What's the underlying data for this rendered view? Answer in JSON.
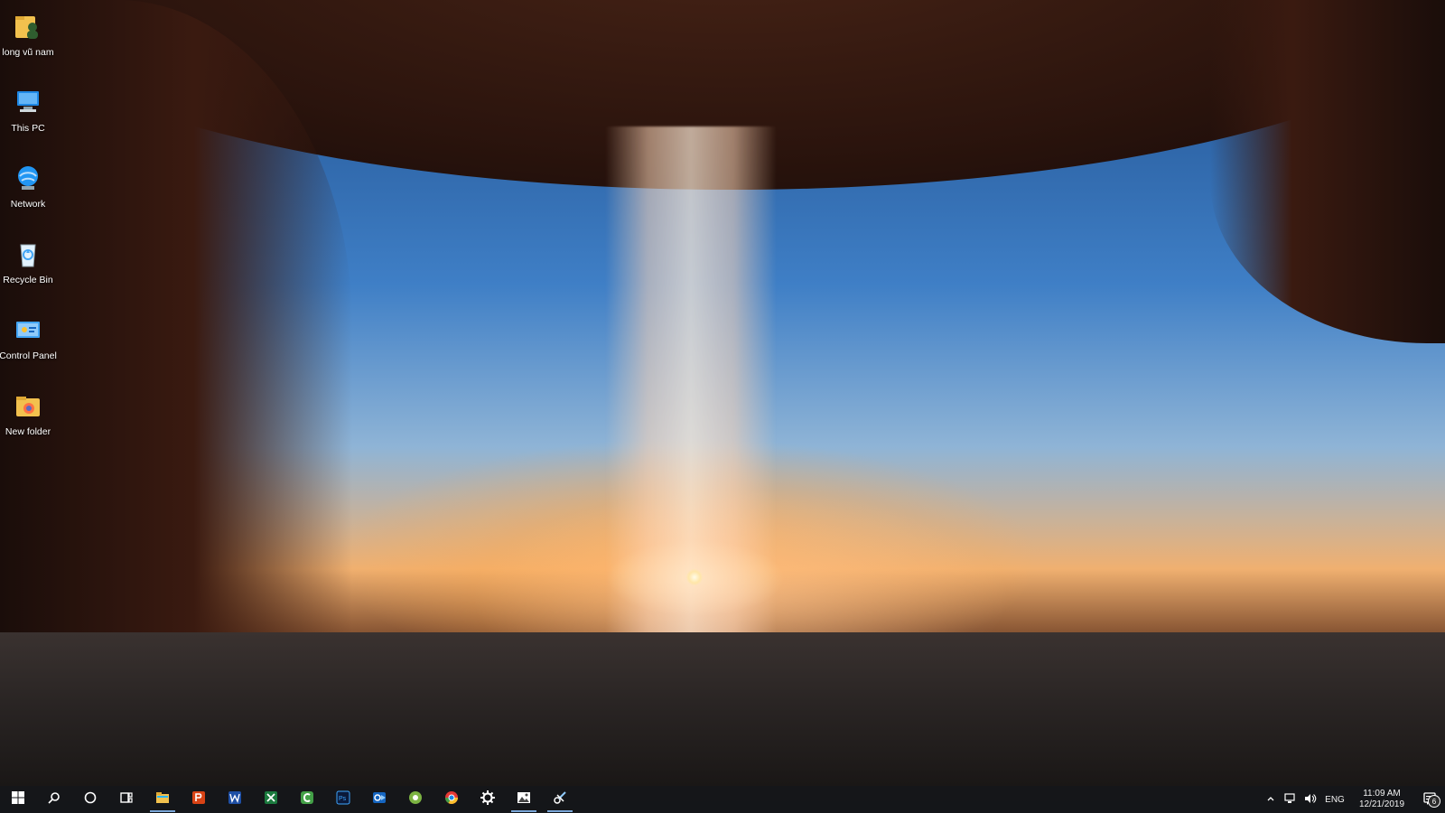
{
  "desktop": {
    "icons": [
      {
        "label": "long vũ nam",
        "icon": "user-folder-icon"
      },
      {
        "label": "This PC",
        "icon": "this-pc-icon"
      },
      {
        "label": "Network",
        "icon": "network-icon"
      },
      {
        "label": "Recycle Bin",
        "icon": "recycle-bin-icon"
      },
      {
        "label": "Control Panel",
        "icon": "control-panel-icon"
      },
      {
        "label": "New folder",
        "icon": "folder-icon"
      }
    ]
  },
  "taskbar": {
    "pinned": [
      {
        "name": "start",
        "icon": "windows-logo-icon"
      },
      {
        "name": "search",
        "icon": "search-icon"
      },
      {
        "name": "cortana",
        "icon": "cortana-ring-icon"
      },
      {
        "name": "task-view",
        "icon": "task-view-icon"
      },
      {
        "name": "file-explorer",
        "icon": "file-explorer-icon"
      },
      {
        "name": "powerpoint",
        "icon": "powerpoint-icon"
      },
      {
        "name": "word",
        "icon": "word-icon"
      },
      {
        "name": "excel",
        "icon": "excel-icon"
      },
      {
        "name": "camtasia",
        "icon": "camtasia-icon"
      },
      {
        "name": "photoshop",
        "icon": "photoshop-icon"
      },
      {
        "name": "outlook",
        "icon": "outlook-icon"
      },
      {
        "name": "greenshot",
        "icon": "greenshot-icon"
      },
      {
        "name": "chrome",
        "icon": "chrome-icon"
      },
      {
        "name": "settings",
        "icon": "gear-icon"
      },
      {
        "name": "photos",
        "icon": "photos-icon"
      },
      {
        "name": "snipping",
        "icon": "snipping-tool-icon"
      }
    ],
    "tray": {
      "language": "ENG",
      "time": "11:09 AM",
      "date": "12/21/2019",
      "notifications": "6"
    }
  },
  "colors": {
    "taskbar_bg": "#14161a",
    "running_indicator": "#7aa6d8"
  }
}
